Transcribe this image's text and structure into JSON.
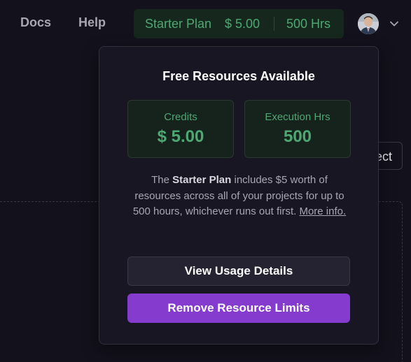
{
  "nav": {
    "docs": "Docs",
    "help": "Help"
  },
  "plan_pill": {
    "name": "Starter Plan",
    "credits": "$ 5.00",
    "hours": "500 Hrs"
  },
  "background": {
    "button_partial_label": "ect"
  },
  "popover": {
    "title": "Free Resources Available",
    "credits_label": "Credits",
    "credits_value": "$ 5.00",
    "hours_label": "Execution Hrs",
    "hours_value": "500",
    "desc_prefix": "The ",
    "desc_plan": "Starter Plan",
    "desc_body": " includes $5 worth of resources across all of your projects for up to 500 hours, whichever runs out first. ",
    "desc_link": "More info.",
    "view_usage_label": "View Usage Details",
    "remove_limits_label": "Remove Resource Limits"
  },
  "colors": {
    "background": "#13111c",
    "popover_bg": "#181622",
    "accent_green": "#4ea873",
    "primary_purple": "#853bce"
  },
  "icons": {
    "avatar": "user-avatar",
    "chevron": "chevron-down-icon"
  }
}
